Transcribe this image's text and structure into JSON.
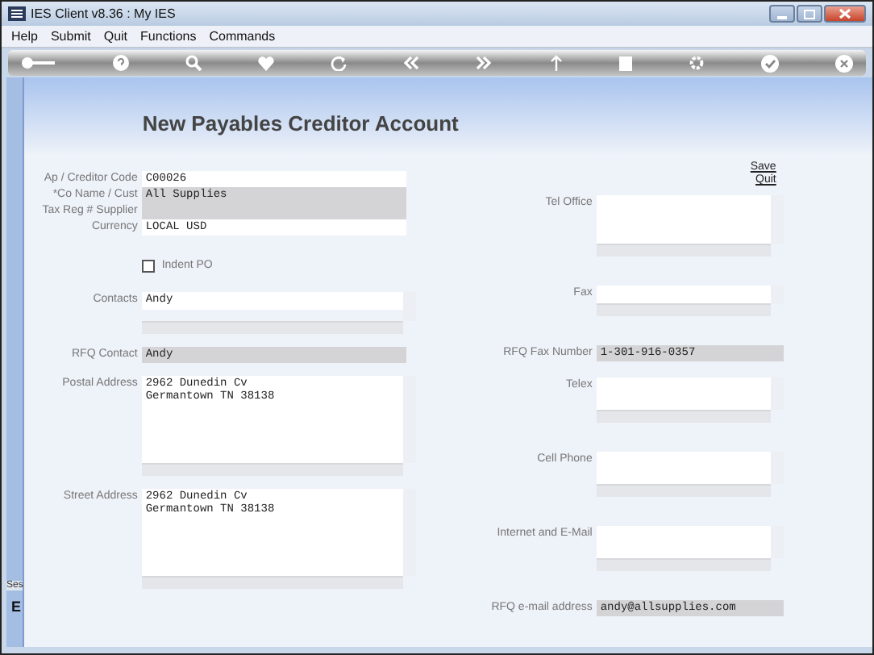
{
  "window": {
    "title": "IES Client v8.36 : My IES"
  },
  "menu": [
    "Help",
    "Submit",
    "Quit",
    "Functions",
    "Commands"
  ],
  "page_title": "New Payables Creditor Account",
  "links": [
    "Save",
    "Quit"
  ],
  "side_strip": [
    "Ses",
    "E"
  ],
  "account_fields": [
    {
      "label": "Ap / Creditor Code",
      "value": "C00026",
      "readonly": false
    },
    {
      "label": "*Co Name / Cust",
      "value": "All Supplies",
      "readonly": true
    },
    {
      "label": "Tax Reg # Supplier",
      "readonly": true
    },
    {
      "label": "Currency",
      "value": "LOCAL USD",
      "readonly": false
    }
  ],
  "left_fields": [
    {
      "label": "Indent PO",
      "kind": "checkbox",
      "checked": false
    },
    {
      "label": "Contacts",
      "value": "Andy",
      "kind": "list",
      "readonly": false
    },
    {
      "label": "RFQ Contact",
      "value": "Andy",
      "kind": "text",
      "readonly": true
    },
    {
      "label": "Postal Address",
      "value": "2962 Dunedin Cv\nGermantown TN 38138",
      "kind": "tall",
      "readonly": false
    },
    {
      "label": "Street Address",
      "value": "2962 Dunedin Cv\nGermantown TN 38138",
      "kind": "tall",
      "readonly": false
    }
  ],
  "right_fields": [
    {
      "label": "Tel Office",
      "kind": "box",
      "readonly": false
    },
    {
      "label": "Fax",
      "kind": "list",
      "readonly": false
    },
    {
      "label": "RFQ Fax Number",
      "value": "1-301-916-0357",
      "kind": "text",
      "readonly": true
    },
    {
      "label": "Telex",
      "kind": "small",
      "readonly": false
    },
    {
      "label": "Cell Phone",
      "kind": "small",
      "readonly": false
    },
    {
      "label": "Internet and E-Mail",
      "kind": "small",
      "readonly": false
    },
    {
      "label": "RFQ e-mail address",
      "value": "andy@allsupplies.com",
      "kind": "text",
      "readonly": true
    }
  ]
}
